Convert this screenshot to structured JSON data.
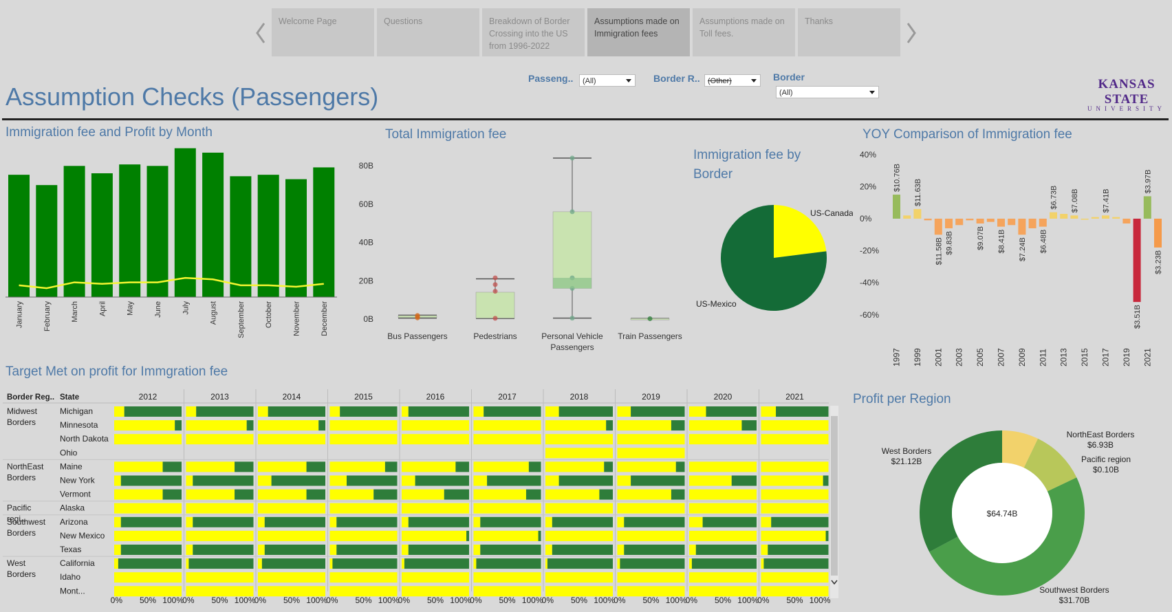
{
  "story": {
    "tabs": [
      {
        "label": "Welcome Page"
      },
      {
        "label": "Questions"
      },
      {
        "label": "Breakdown of Border Crossing into the US from 1996-2022"
      },
      {
        "label": "Assumptions made on Immigration fees"
      },
      {
        "label": "Assumptions made on Toll fees."
      },
      {
        "label": "Thanks"
      }
    ],
    "active_index": 3
  },
  "page_title": "Assumption Checks (Passengers)",
  "filters": [
    {
      "label": "Passeng..",
      "value": "(All)"
    },
    {
      "label": "Border R..",
      "value": "(Other)"
    },
    {
      "label": "Border",
      "value": "(All)"
    }
  ],
  "logo": {
    "line1": "KANSAS STATE",
    "line2": "UNIVERSITY"
  },
  "colors": {
    "title_blue": "#4e79a7",
    "dark_green": "#008000",
    "yellow": "#ffff00",
    "k_state_purple": "#512888"
  },
  "sheet_titles": {
    "monthly": "Immigration fee and Profit by Month",
    "total": "Total Immigration fee",
    "border_pie": "Immigration fee by Border",
    "yoy": "YOY Comparison of Immigration fee",
    "target": "Target Met on profit for Immgration  fee",
    "region": "Profit per Region"
  },
  "chart_data": [
    {
      "type": "bar",
      "title": "Immigration fee and Profit by Month",
      "categories": [
        "January",
        "February",
        "March",
        "April",
        "May",
        "June",
        "July",
        "August",
        "September",
        "October",
        "November",
        "December"
      ],
      "series": [
        {
          "values": [
            83,
            76,
            89,
            84,
            90,
            89,
            101,
            98,
            82,
            83,
            80,
            88
          ]
        },
        {
          "values": [
            8,
            6,
            10,
            9,
            10,
            10,
            13,
            12,
            8,
            8,
            7,
            9
          ]
        }
      ]
    },
    {
      "type": "scatter",
      "title": "Total Immigration fee",
      "categories": [
        "Bus Passengers",
        "Pedestrians",
        "Personal Vehicle Passengers",
        "Train Passengers"
      ],
      "yticks": [
        "0B",
        "20B",
        "40B",
        "60B",
        "80B"
      ],
      "ylim": [
        0,
        85
      ],
      "boxes": [
        {
          "whisker_low": 0.5,
          "q1": 0.8,
          "q3": 1.8,
          "whisker_high": 2.0,
          "points": [
            0.6,
            1.2,
            1.9
          ]
        },
        {
          "whisker_low": 0.3,
          "q1": 0.5,
          "q3": 14.0,
          "whisker_high": 21.0,
          "points": [
            0.4,
            14.5,
            18.0,
            21.5
          ]
        },
        {
          "whisker_low": 0.5,
          "q1": 16.0,
          "q3": 56.0,
          "whisker_high": 84.0,
          "points": [
            0.5,
            16.0,
            21.5,
            56.0,
            84.0
          ]
        },
        {
          "whisker_low": 0.1,
          "q1": 0.1,
          "q3": 0.3,
          "whisker_high": 0.3,
          "points": [
            0.2
          ]
        }
      ]
    },
    {
      "type": "pie",
      "title": "Immigration fee by Border",
      "categories": [
        "US-Canada",
        "US-Mexico"
      ],
      "values": [
        23,
        77
      ]
    },
    {
      "type": "bar",
      "title": "YOY Comparison of Immigration fee",
      "x": [
        "1997",
        "1998",
        "1999",
        "2000",
        "2001",
        "2002",
        "2003",
        "2004",
        "2005",
        "2006",
        "2007",
        "2008",
        "2009",
        "2010",
        "2011",
        "2012",
        "2013",
        "2014",
        "2015",
        "2016",
        "2017",
        "2018",
        "2019",
        "2020",
        "2021",
        "2022"
      ],
      "xticks": [
        "1997",
        "1999",
        "2001",
        "2003",
        "2005",
        "2007",
        "2009",
        "2011",
        "2013",
        "2015",
        "2017",
        "2019",
        "2021"
      ],
      "values": [
        15,
        2,
        6,
        -1,
        -10,
        -6,
        -4,
        -1,
        -3,
        -2,
        -5,
        -4,
        -10,
        -6,
        -5,
        4,
        3,
        2,
        0,
        1,
        2,
        1,
        -3,
        -52,
        14,
        -18
      ],
      "labels": [
        "$10.76B",
        "",
        "$11.63B",
        "",
        "$11.58B",
        "$9.83B",
        "",
        "",
        "$9.07B",
        "",
        "$8.41B",
        "",
        "$7.24B",
        "",
        "$6.48B",
        "$6.73B",
        "",
        "$7.08B",
        "",
        "",
        "$7.41B",
        "",
        "",
        "$3.51B",
        "$3.97B",
        "$3.23B"
      ],
      "yticks": [
        "40%",
        "20%",
        "0%",
        "-20%",
        "-40%",
        "-60%"
      ],
      "ylim": [
        -65,
        42
      ]
    },
    {
      "type": "bar",
      "title": "Target Met on profit for Immgration  fee",
      "column_headers": [
        "Border Reg..",
        "State"
      ],
      "years": [
        "2012",
        "2013",
        "2014",
        "2015",
        "2016",
        "2017",
        "2018",
        "2019",
        "2020",
        "2021"
      ],
      "xticks": [
        "0%",
        "50%",
        "100%"
      ],
      "groups": [
        {
          "region": "Midwest Borders",
          "states": [
            "Michigan",
            "Minnesota",
            "North Dakota",
            "Ohio"
          ]
        },
        {
          "region": "NorthEast Borders",
          "states": [
            "Maine",
            "New York",
            "Vermont"
          ]
        },
        {
          "region": "Pacific regi..",
          "states": [
            "Alaska"
          ]
        },
        {
          "region": "Southwest Borders",
          "states": [
            "Arizona",
            "New Mexico",
            "Texas"
          ]
        },
        {
          "region": "West Borders",
          "states": [
            "California",
            "Idaho",
            "Mont..."
          ]
        }
      ],
      "yellow_share": [
        [
          15,
          15,
          15,
          15,
          10,
          15,
          20,
          20,
          25,
          22
        ],
        [
          90,
          90,
          90,
          100,
          100,
          100,
          90,
          80,
          78,
          100
        ],
        [
          100,
          100,
          100,
          100,
          100,
          100,
          100,
          100,
          100,
          100
        ],
        [
          null,
          null,
          null,
          null,
          null,
          null,
          100,
          100,
          null,
          null
        ],
        [
          72,
          72,
          72,
          82,
          80,
          82,
          87,
          87,
          100,
          100
        ],
        [
          10,
          10,
          20,
          25,
          20,
          20,
          20,
          20,
          63,
          92
        ],
        [
          72,
          72,
          72,
          65,
          63,
          78,
          80,
          80,
          100,
          100
        ],
        [
          100,
          100,
          100,
          100,
          100,
          100,
          100,
          100,
          100,
          100
        ],
        [
          10,
          10,
          10,
          10,
          10,
          10,
          10,
          10,
          20,
          15
        ],
        [
          100,
          100,
          100,
          100,
          96,
          96,
          100,
          100,
          100,
          96
        ],
        [
          10,
          10,
          10,
          10,
          10,
          10,
          10,
          10,
          10,
          10
        ],
        [
          6,
          4,
          6,
          4,
          4,
          4,
          3,
          4,
          4,
          4
        ],
        [
          100,
          100,
          100,
          100,
          100,
          100,
          100,
          100,
          100,
          100
        ],
        [
          100,
          100,
          100,
          100,
          100,
          100,
          100,
          100,
          100,
          100
        ]
      ]
    },
    {
      "type": "pie",
      "title": "Profit per Region",
      "center_label": "$64.74B",
      "categories": [
        "West Borders",
        "NorthEast Borders",
        "Pacific region",
        "Southwest Borders"
      ],
      "values": [
        21.12,
        6.93,
        0.1,
        31.7
      ],
      "value_labels": [
        "$21.12B",
        "$6.93B",
        "$0.10B",
        "$31.70B"
      ],
      "colors": [
        "#2e7d3a",
        "#b8c75a",
        "#f2d26b",
        "#4a9e4a"
      ]
    }
  ]
}
